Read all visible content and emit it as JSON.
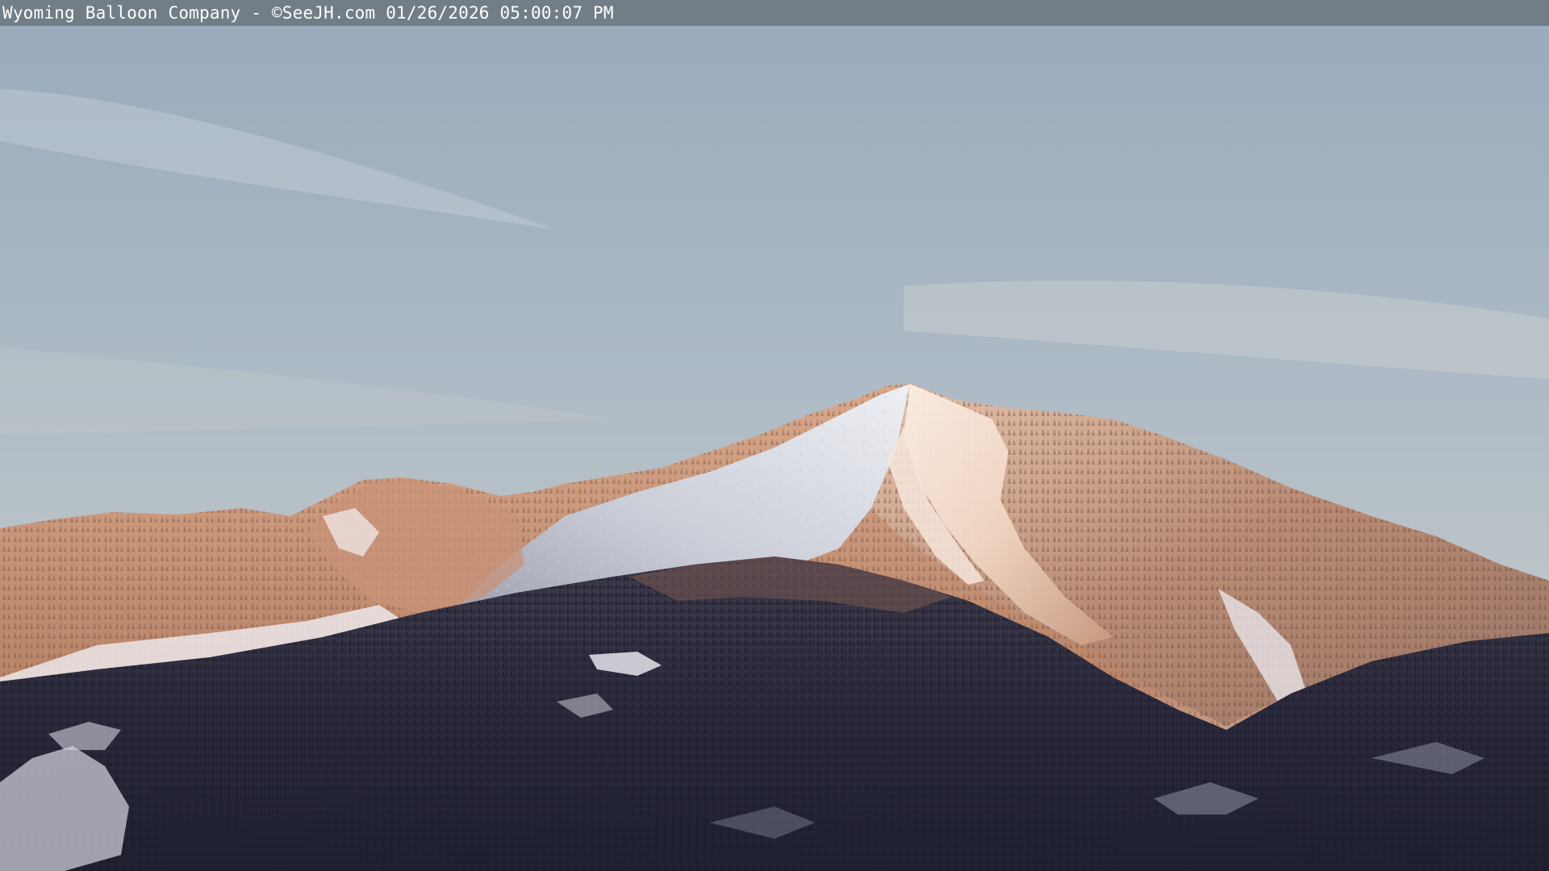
{
  "overlay": {
    "caption": "Wyoming Balloon Company - ©SeeJH.com 01/26/2026 05:00:07 PM"
  },
  "colors": {
    "sky_top": "#9aacbc",
    "sky_bottom": "#c3c9c8",
    "snow_lit": "#f4e0d2",
    "snow_shade": "#d9dde6",
    "rock_lit": "#c99a7c",
    "forest_dark": "#2a2b3e",
    "overlay_bar": "#6e7a82"
  }
}
